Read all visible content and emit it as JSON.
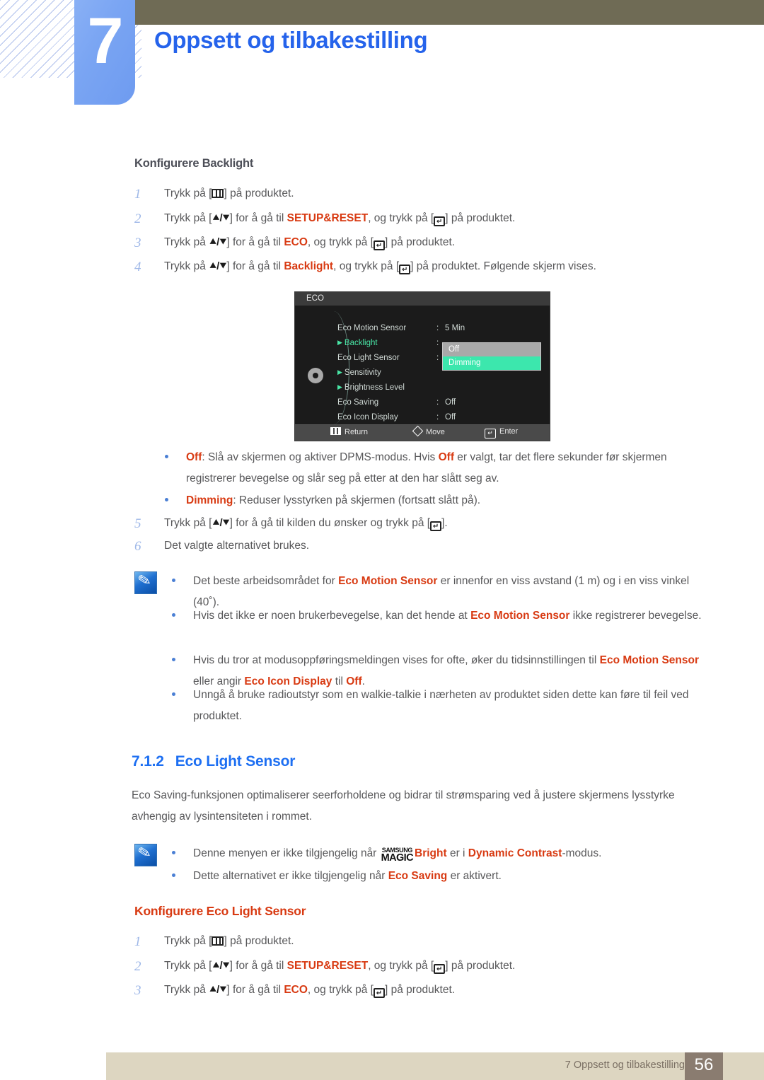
{
  "header": {
    "chapter_number": "7",
    "chapter_title": "Oppsett og tilbakestilling",
    "accent_blue": "#2563eb",
    "tab_blue": "#7aa5f3",
    "bar_olive": "#6f6b55"
  },
  "section_backlight": {
    "heading": "Konfigurere Backlight",
    "steps": [
      {
        "num": "1",
        "pre": "Trykk på [",
        "key": "menu-key",
        "post": "] på produktet."
      },
      {
        "num": "2",
        "pre": "Trykk på [",
        "key": "up-down-key",
        "mid": "] for å gå til ",
        "kw": "SETUP&RESET",
        "mid2": ", og trykk på [",
        "key2": "enter-key",
        "post": "] på produktet."
      },
      {
        "num": "3",
        "pre": "Trykk på ",
        "key": "up-down-key",
        "mid": "] for å gå til ",
        "kw": "ECO",
        "mid2": ", og trykk på [",
        "key2": "enter-key",
        "post": "] på produktet."
      },
      {
        "num": "4",
        "pre": "Trykk på ",
        "key": "up-down-key",
        "mid": "] for å gå til ",
        "kw": "Backlight",
        "mid2": ", og trykk på [",
        "key2": "enter-key",
        "post": "] på produktet. Følgende skjerm vises."
      }
    ],
    "steps_after": [
      {
        "num": "5",
        "pre": "Trykk på [",
        "key": "up-down-key",
        "mid": "] for å gå til kilden du ønsker og trykk på [",
        "key2": "enter-key",
        "post": "]."
      },
      {
        "num": "6",
        "pre": "Det valgte alternativet brukes.",
        "key": "",
        "post": ""
      }
    ],
    "bullets": [
      {
        "kw": "Off",
        "text": ": Slå av skjermen og aktiver DPMS-modus. Hvis ",
        "kw2": "Off",
        "text2": " er valgt, tar det flere sekunder før skjermen registrerer bevegelse og slår seg på etter at den har slått seg av."
      },
      {
        "kw": "Dimming",
        "text": ": Reduser lysstyrken på skjermen (fortsatt slått på)."
      }
    ]
  },
  "osd": {
    "title": "ECO",
    "rows": [
      {
        "label": "Eco Motion Sensor",
        "colon": ":",
        "value": "5 Min",
        "selected": false,
        "caret": false
      },
      {
        "label": "Backlight",
        "colon": ":",
        "value": "",
        "selected": true,
        "caret": true
      },
      {
        "label": "Eco Light Sensor",
        "colon": ":",
        "value": "",
        "selected": false,
        "caret": false
      },
      {
        "label": "Sensitivity",
        "colon": "",
        "value": "",
        "selected": false,
        "caret": true
      },
      {
        "label": "Brightness Level",
        "colon": "",
        "value": "",
        "selected": false,
        "caret": true
      },
      {
        "label": "Eco Saving",
        "colon": ":",
        "value": "Off",
        "selected": false,
        "caret": false
      },
      {
        "label": "Eco Icon Display",
        "colon": ":",
        "value": "Off",
        "selected": false,
        "caret": false
      }
    ],
    "dropdown": {
      "options": [
        "Off",
        "Dimming"
      ],
      "highlighted": "Dimming",
      "highlight_color": "#3ce7ad",
      "background_color": "#a9a9a9"
    },
    "footer": {
      "return": "Return",
      "move": "Move",
      "enter": "Enter"
    }
  },
  "note1": {
    "bullets": [
      {
        "text": "Det beste arbeidsområdet for ",
        "kw": "Eco Motion Sensor",
        "text2": " er innenfor en viss avstand (1 m) og i en viss vinkel (40˚)."
      },
      {
        "text": "Hvis det ikke er noen brukerbevegelse, kan det hende at ",
        "kw": "Eco Motion Sensor",
        "text2": " ikke registrerer bevegelse."
      },
      {
        "text": "Hvis du tror at modusoppføringsmeldingen vises for ofte, øker du tidsinnstillingen til ",
        "kw": "Eco Motion Sensor",
        "text2": " eller angir ",
        "kw2": "Eco Icon Display",
        "text3": " til ",
        "kw3": "Off",
        "text4": "."
      },
      {
        "text": "Unngå å bruke radioutstyr som en walkie-talkie i nærheten av produktet siden dette kan føre til feil ved produktet."
      }
    ]
  },
  "section_eco_light": {
    "number": "7.1.2",
    "title": "Eco Light Sensor",
    "paragraph": "Eco Saving-funksjonen optimaliserer seerforholdene og bidrar til strømsparing ved å justere skjermens lysstyrke avhengig av lysintensiteten i rommet.",
    "note_bullets": [
      {
        "text": "Denne menyen er ikke tilgjengelig når ",
        "magic_line1": "SAMSUNG",
        "magic_line2": "MAGIC",
        "kw": "Bright",
        "text2": " er i ",
        "kw2": "Dynamic Contrast",
        "text3": "-modus."
      },
      {
        "text": "Dette alternativet er ikke tilgjengelig når ",
        "kw": "Eco Saving",
        "text2": " er aktivert."
      }
    ],
    "sub_heading": "Konfigurere Eco Light Sensor",
    "steps": [
      {
        "num": "1",
        "pre": "Trykk på [",
        "key": "menu-key",
        "post": "] på produktet."
      },
      {
        "num": "2",
        "pre": "Trykk på [",
        "key": "up-down-key",
        "mid": "] for å gå til ",
        "kw": "SETUP&RESET",
        "mid2": ", og trykk på [",
        "key2": "enter-key",
        "post": "] på produktet."
      },
      {
        "num": "3",
        "pre": "Trykk på ",
        "key": "up-down-key",
        "mid": "] for å gå til ",
        "kw": "ECO",
        "mid2": ", og trykk på [",
        "key2": "enter-key",
        "post": "] på produktet."
      }
    ]
  },
  "footer": {
    "text": "7 Oppsett og tilbakestilling",
    "page": "56",
    "band_color": "#ddd6c1",
    "page_box_color": "#8a7c70"
  }
}
